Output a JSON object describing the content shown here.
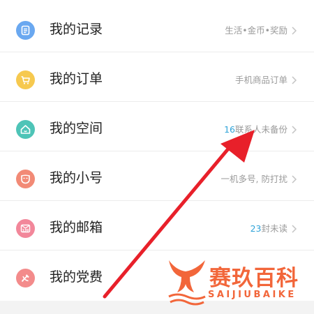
{
  "menu": {
    "items": [
      {
        "id": "records",
        "label": "我的记录",
        "right_num": "",
        "right_text": "生活•金币•奖励",
        "icon": "list-icon",
        "icon_color": "#6aa8f0"
      },
      {
        "id": "orders",
        "label": "我的订单",
        "right_num": "",
        "right_text": "手机商品订单",
        "icon": "cart-icon",
        "icon_color": "#f6c94f"
      },
      {
        "id": "space",
        "label": "我的空间",
        "right_num": "16",
        "right_text": "联系人未备份",
        "icon": "home-icon",
        "icon_color": "#4ec4b7"
      },
      {
        "id": "sub-number",
        "label": "我的小号",
        "right_num": "",
        "right_text": "一机多号, 防打扰",
        "icon": "mask-icon",
        "icon_color": "#f28a76"
      },
      {
        "id": "mailbox",
        "label": "我的邮箱",
        "right_num": "23",
        "right_text": "封未读",
        "icon": "mail-139-icon",
        "icon_color": "#f2879a"
      },
      {
        "id": "party-fee",
        "label": "我的党费",
        "right_num": "",
        "right_text": "",
        "icon": "party-emblem-icon",
        "icon_color": "#f38b8b"
      }
    ]
  },
  "mail_icon_text": "139",
  "watermark": {
    "cn": "赛玖百科",
    "en": "SAIJIUBAIKE",
    "color": "#f2663a"
  },
  "annotation": {
    "arrow_color": "#e8202a"
  }
}
